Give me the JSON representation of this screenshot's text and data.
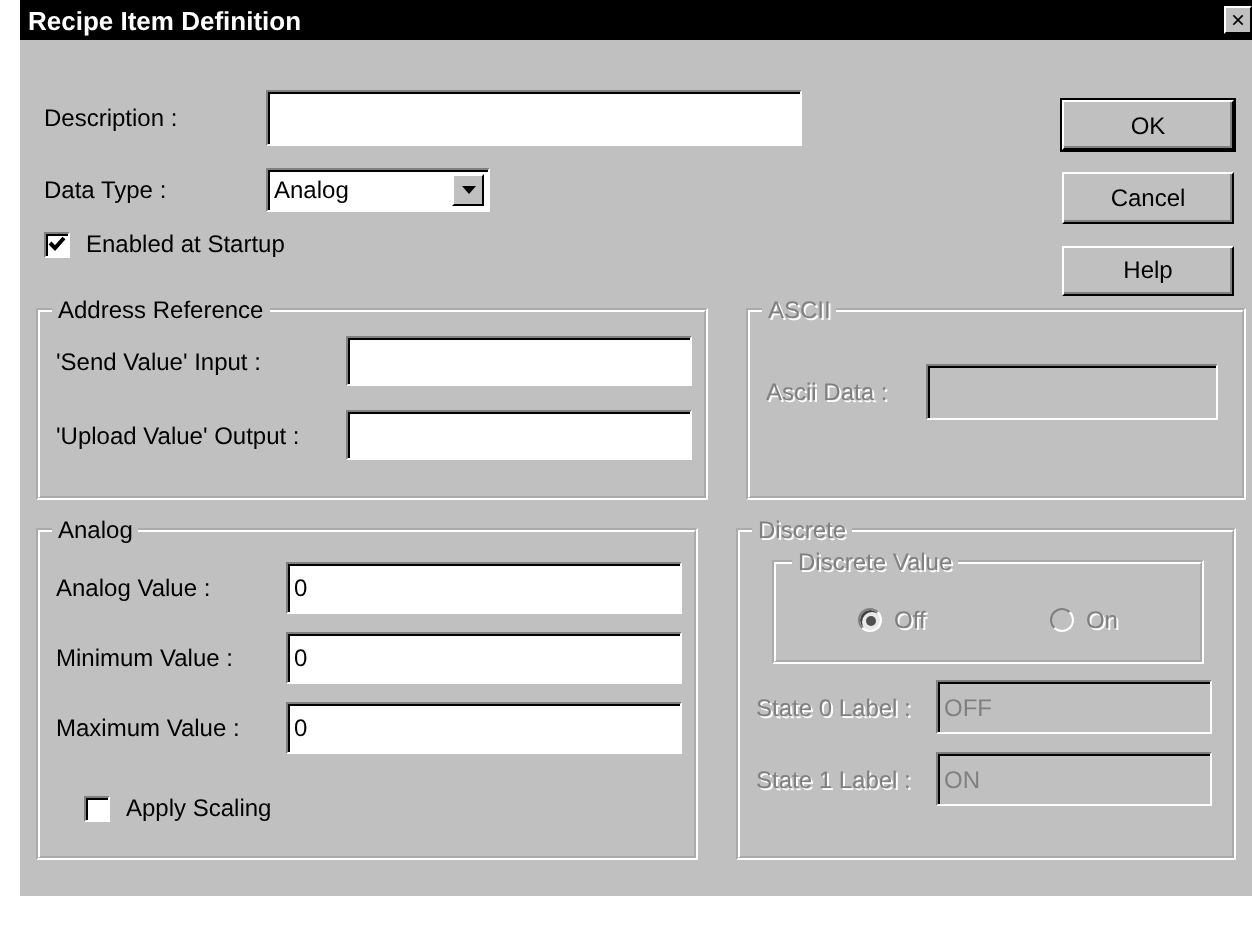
{
  "window": {
    "title": "Recipe Item Definition",
    "close": "×"
  },
  "description": {
    "label": "Description :"
  },
  "data_type": {
    "label": "Data Type :",
    "value": "Analog"
  },
  "enabled_at_startup": {
    "label": "Enabled at Startup",
    "checked": true
  },
  "buttons": [
    {
      "label": "OK",
      "default": true
    },
    {
      "label": "Cancel",
      "default": false
    },
    {
      "label": "Help",
      "default": false
    }
  ],
  "address_reference": {
    "title": "Address Reference",
    "disabled": false,
    "fields": [
      {
        "label": "'Send Value' Input :"
      },
      {
        "label": "'Upload Value' Output :"
      }
    ]
  },
  "ascii": {
    "title": "ASCII",
    "disabled": true,
    "fields": [
      {
        "label": "Ascii Data :"
      }
    ]
  },
  "analog": {
    "title": "Analog",
    "disabled": false,
    "fields": [
      {
        "label": "Analog Value :",
        "value": "0"
      },
      {
        "label": "Minimum Value :",
        "value": "0"
      },
      {
        "label": "Maximum Value :",
        "value": "0"
      }
    ],
    "apply_scaling": {
      "label": "Apply Scaling",
      "checked": false
    }
  },
  "discrete": {
    "title": "Discrete",
    "disabled": true,
    "discrete_value": {
      "title": "Discrete Value",
      "options": [
        {
          "label": "Off",
          "selected": true
        },
        {
          "label": "On",
          "selected": false
        }
      ]
    },
    "fields": [
      {
        "label": "State 0 Label :",
        "value": "OFF"
      },
      {
        "label": "State 1 Label :",
        "value": "ON"
      }
    ]
  }
}
